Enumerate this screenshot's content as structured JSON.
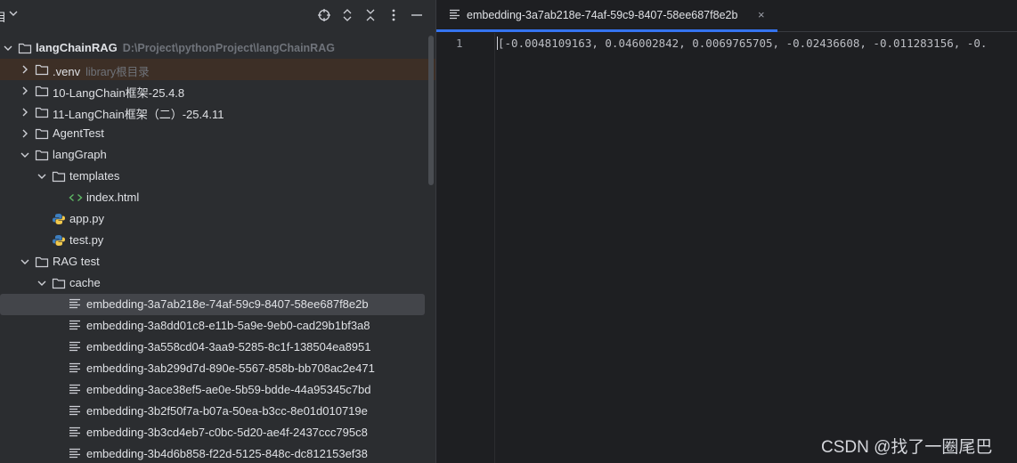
{
  "panel": {
    "title": "目"
  },
  "tree": [
    {
      "label": "langChainRAG",
      "hint": "D:\\Project\\pythonProject\\langChainRAG",
      "type": "folder",
      "depth": 0,
      "expanded": true,
      "bold": true
    },
    {
      "label": ".venv",
      "hint": "library根目录",
      "type": "folder",
      "depth": 1,
      "expanded": false,
      "highlight": true
    },
    {
      "label": "10-LangChain框架-25.4.8",
      "type": "folder",
      "depth": 1,
      "expanded": false
    },
    {
      "label": "11-LangChain框架（二）-25.4.11",
      "type": "folder",
      "depth": 1,
      "expanded": false
    },
    {
      "label": "AgentTest",
      "type": "folder",
      "depth": 1,
      "expanded": false
    },
    {
      "label": "langGraph",
      "type": "folder",
      "depth": 1,
      "expanded": true
    },
    {
      "label": "templates",
      "type": "folder",
      "depth": 2,
      "expanded": true
    },
    {
      "label": "index.html",
      "type": "html",
      "depth": 3
    },
    {
      "label": "app.py",
      "type": "python",
      "depth": 2
    },
    {
      "label": "test.py",
      "type": "python",
      "depth": 2
    },
    {
      "label": "RAG test",
      "type": "folder",
      "depth": 1,
      "expanded": true
    },
    {
      "label": "cache",
      "type": "folder",
      "depth": 2,
      "expanded": true
    },
    {
      "label": "embedding-3a7ab218e-74af-59c9-8407-58ee687f8e2b",
      "type": "text",
      "depth": 3,
      "selected": true
    },
    {
      "label": "embedding-3a8dd01c8-e11b-5a9e-9eb0-cad29b1bf3a8",
      "type": "text",
      "depth": 3
    },
    {
      "label": "embedding-3a558cd04-3aa9-5285-8c1f-138504ea8951",
      "type": "text",
      "depth": 3
    },
    {
      "label": "embedding-3ab299d7d-890e-5567-858b-bb708ac2e471",
      "type": "text",
      "depth": 3
    },
    {
      "label": "embedding-3ace38ef5-ae0e-5b59-bdde-44a95345c7bd",
      "type": "text",
      "depth": 3
    },
    {
      "label": "embedding-3b2f50f7a-b07a-50ea-b3cc-8e01d010719e",
      "type": "text",
      "depth": 3
    },
    {
      "label": "embedding-3b3cd4eb7-c0bc-5d20-ae4f-2437ccc795c8",
      "type": "text",
      "depth": 3
    },
    {
      "label": "embedding-3b4d6b858-f22d-5125-848c-dc812153ef38",
      "type": "text",
      "depth": 3
    }
  ],
  "editor": {
    "tab_label": "embedding-3a7ab218e-74af-59c9-8407-58ee687f8e2b",
    "tab_close": "×",
    "line_number": "1",
    "code": "[-0.0048109163, 0.046002842, 0.0069765705, -0.02436608, -0.011283156, -0."
  },
  "watermark": "CSDN @找了一圈尾巴",
  "colors": {
    "accent": "#3574f0",
    "folder": "#ced0d6",
    "highlight_row": "#3d2f26",
    "selected_row": "#43454a"
  }
}
